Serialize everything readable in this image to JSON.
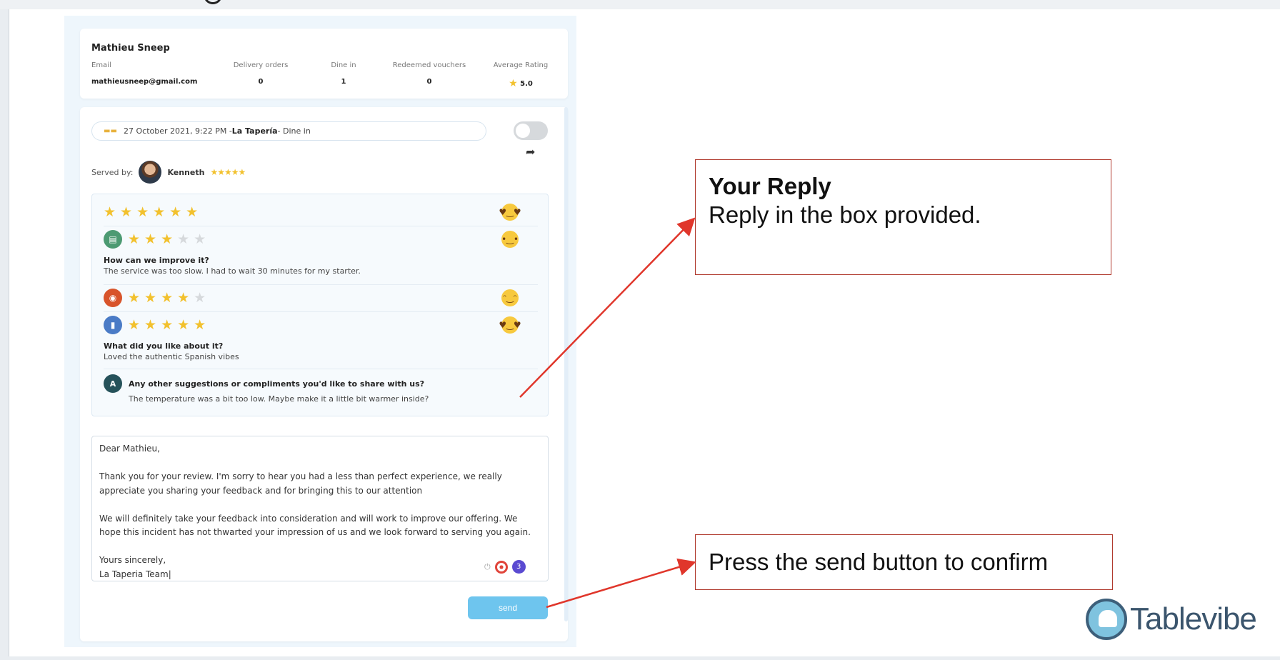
{
  "customer": {
    "name": "Mathieu Sneep",
    "email_label": "Email",
    "email": "mathieusneep@gmail.com",
    "delivery_label": "Delivery orders",
    "delivery": "0",
    "dinein_label": "Dine in",
    "dinein": "1",
    "vouchers_label": "Redeemed vouchers",
    "vouchers": "0",
    "rating_label": "Average Rating",
    "rating": "5.0"
  },
  "review": {
    "date": "27 October 2021, 9:22 PM -",
    "restaurant": "La Tapería",
    "type": "- Dine in",
    "served_label": "Served by:",
    "waiter": "Kenneth",
    "waiter_rating": 5,
    "ratings": [
      {
        "category_icon": "none",
        "stars": 6,
        "of": 6,
        "emoji": "heart-eyes-emoji"
      },
      {
        "category_icon": "burger-icon",
        "stars": 3,
        "of": 5,
        "emoji": "neutral-emoji"
      },
      {
        "category_icon": "food-icon",
        "stars": 4,
        "of": 5,
        "emoji": "smile-emoji"
      },
      {
        "category_icon": "drink-icon",
        "stars": 5,
        "of": 5,
        "emoji": "heart-eyes-emoji"
      }
    ],
    "q1": "How can we improve it?",
    "a1": "The service was too slow. I had to wait 30 minutes for my starter.",
    "q2": "What did you like about it?",
    "a2": "Loved the authentic Spanish vibes",
    "q3_badge": "A",
    "q3": "Any other suggestions or compliments you'd like to share with us?",
    "a3": "The temperature was a bit too low. Maybe make it a little bit warmer inside?"
  },
  "reply": {
    "l1": "Dear Mathieu,",
    "l2": "Thank you for your review. I'm sorry to hear you had a less than  perfect experience,  we really appreciate you sharing your feedback and for bringing this to our attention",
    "l3": "We will definitely take your feedback into consideration and will work to improve our offering. We hope this incident has not thwarted your impression of us and we look forward to serving you again.",
    "l4a": "Yours sincerely,",
    "l4b": "La Taperia Team",
    "tool_count": "3"
  },
  "send_label": "send",
  "callouts": {
    "c1_title": "Your Reply",
    "c1_text": "Reply in the box provided.",
    "c2_text": "Press the send button to confirm"
  },
  "brand": "Tablevibe",
  "colors": {
    "accent": "#6ec5ee",
    "star": "#f2c12e",
    "callout_border": "#b03a2e",
    "arrow": "#e0362b"
  }
}
